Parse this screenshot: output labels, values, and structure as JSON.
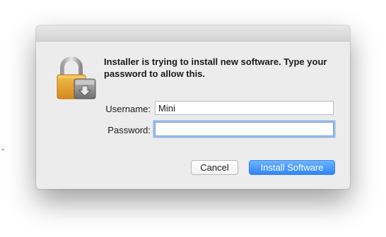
{
  "dialog": {
    "message": "Installer is trying to install new software. Type your password to allow this.",
    "username_label": "Username:",
    "username_value": "Mini",
    "password_label": "Password:",
    "password_value": "",
    "cancel_label": "Cancel",
    "install_label": "Install Software",
    "icon": "lock-installer-icon"
  },
  "colors": {
    "accent": "#3a8ef6",
    "focus_ring": "#6c9ee6",
    "lock_body": "#e8a32a",
    "background": "#ececec"
  }
}
